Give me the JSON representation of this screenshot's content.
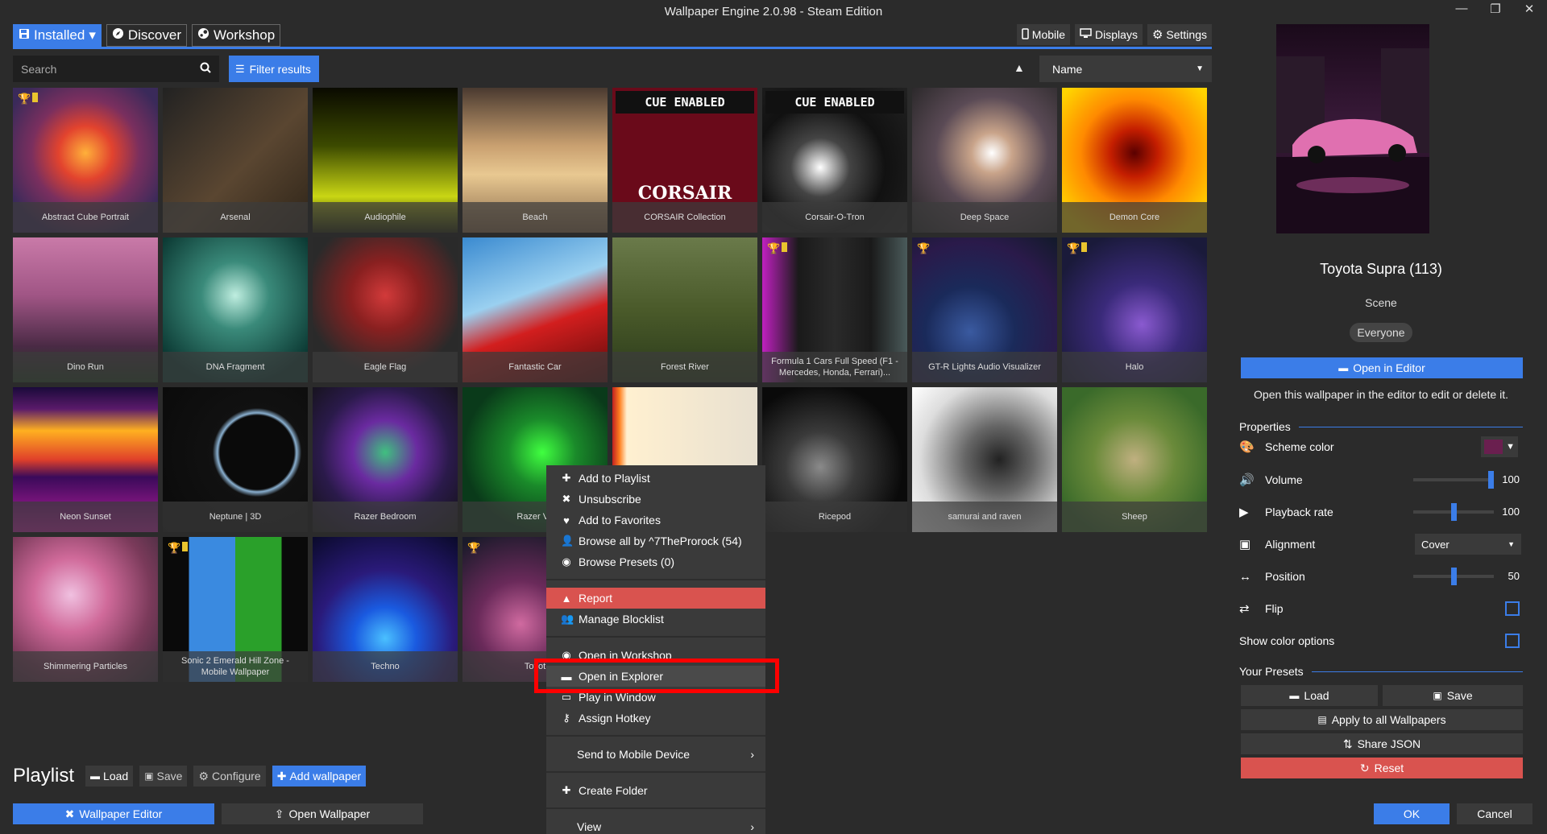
{
  "window": {
    "title": "Wallpaper Engine 2.0.98 - Steam Edition",
    "minimize": "—",
    "restore": "❐",
    "close": "✕"
  },
  "tabs": [
    {
      "label": "Installed",
      "icon": "save-icon",
      "caret": "▾"
    },
    {
      "label": "Discover",
      "icon": "compass-icon"
    },
    {
      "label": "Workshop",
      "icon": "steam-icon"
    }
  ],
  "toolbar": {
    "mobile": "Mobile",
    "displays": "Displays",
    "settings": "Settings"
  },
  "search": {
    "placeholder": "Search",
    "filter_label": "Filter results"
  },
  "sort": {
    "direction": "▲",
    "field": "Name"
  },
  "wallpapers": [
    {
      "name": "Abstract Cube Portrait",
      "badges": true
    },
    {
      "name": "Arsenal"
    },
    {
      "name": "Audiophile"
    },
    {
      "name": "Beach"
    },
    {
      "name": "CORSAIR Collection",
      "cue": true,
      "brand": "CORSAIR"
    },
    {
      "name": "Corsair-O-Tron",
      "cue": true
    },
    {
      "name": "Deep Space"
    },
    {
      "name": "Demon Core"
    },
    {
      "name": "Dino Run"
    },
    {
      "name": "DNA Fragment"
    },
    {
      "name": "Eagle Flag"
    },
    {
      "name": "Fantastic Car"
    },
    {
      "name": "Forest River"
    },
    {
      "name": "Formula 1 Cars Full Speed (F1 - Mercedes, Honda, Ferrari)...",
      "badges": true
    },
    {
      "name": "GT-R Lights Audio Visualizer",
      "trophy": true
    },
    {
      "name": "Halo",
      "badges": true
    },
    {
      "name": "Neon Sunset"
    },
    {
      "name": "Neptune | 3D"
    },
    {
      "name": "Razer Bedroom"
    },
    {
      "name": "Razer Vo"
    },
    {
      "name": ""
    },
    {
      "name": "Ricepod"
    },
    {
      "name": "samurai and raven"
    },
    {
      "name": "Sheep"
    },
    {
      "name": "Shimmering Particles"
    },
    {
      "name": "Sonic 2 Emerald Hill Zone - Mobile Wallpaper",
      "badges": true
    },
    {
      "name": "Techno"
    },
    {
      "name": "Toyot",
      "trophy": true
    }
  ],
  "cue_label": "CUE ENABLED",
  "context_menu": {
    "add_playlist": "Add to Playlist",
    "unsubscribe": "Unsubscribe",
    "add_favorites": "Add to Favorites",
    "browse_author": "Browse all by ^7TheProrock (54)",
    "browse_presets": "Browse Presets (0)",
    "report": "Report",
    "manage_blocklist": "Manage Blocklist",
    "open_workshop": "Open in Workshop",
    "open_explorer": "Open in Explorer",
    "play_window": "Play in Window",
    "assign_hotkey": "Assign Hotkey",
    "send_mobile": "Send to Mobile Device",
    "create_folder": "Create Folder",
    "view": "View",
    "chevron": "›"
  },
  "playlist": {
    "title": "Playlist",
    "load": "Load",
    "save": "Save",
    "configure": "Configure",
    "add": "Add wallpaper"
  },
  "bottom": {
    "wallpaper_editor": "Wallpaper Editor",
    "open_wallpaper": "Open Wallpaper"
  },
  "details": {
    "title": "Toyota Supra (113)",
    "type": "Scene",
    "rating": "Everyone",
    "open_editor": "Open in Editor",
    "editor_desc": "Open this wallpaper in the editor to edit or delete it."
  },
  "properties": {
    "header": "Properties",
    "scheme_color": "Scheme color",
    "scheme_hex": "#6a1f4f",
    "volume": "Volume",
    "volume_value": "100",
    "volume_fraction": 1.0,
    "playback_rate": "Playback rate",
    "playback_value": "100",
    "playback_fraction": 0.5,
    "alignment": "Alignment",
    "alignment_value": "Cover",
    "position": "Position",
    "position_value": "50",
    "position_fraction": 0.5,
    "flip": "Flip",
    "show_color": "Show color options"
  },
  "presets": {
    "header": "Your Presets",
    "load": "Load",
    "save": "Save",
    "apply_all": "Apply to all Wallpapers",
    "share_json": "Share JSON",
    "reset": "Reset"
  },
  "dialog": {
    "ok": "OK",
    "cancel": "Cancel"
  },
  "colors": {
    "accent": "#3b7de8",
    "danger": "#d9534f",
    "highlight": "#ff0000"
  }
}
